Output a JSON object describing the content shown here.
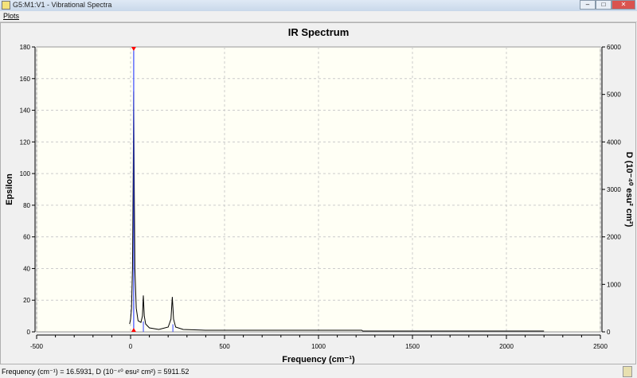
{
  "window": {
    "title": "G5:M1:V1 - Vibrational Spectra",
    "controls": [
      "minimize",
      "maximize",
      "close"
    ]
  },
  "menu": {
    "items": [
      "Plots"
    ]
  },
  "status": {
    "text": "Frequency (cm⁻¹) = 16.5931, D (10⁻⁴⁰ esu² cm²) = 5911.52"
  },
  "chart_data": {
    "type": "line",
    "title": "IR Spectrum",
    "xlabel": "Frequency (cm⁻¹)",
    "ylabel": "Epsilon",
    "y2label": "D (10⁻⁴⁰ esu² cm²)",
    "xlim": [
      -500,
      2500
    ],
    "ylim": [
      0,
      180
    ],
    "y2lim": [
      0,
      6000
    ],
    "xticks": [
      -500,
      0,
      500,
      1000,
      1500,
      2000,
      2500
    ],
    "yticks": [
      0,
      20,
      40,
      60,
      80,
      100,
      120,
      140,
      160,
      180
    ],
    "y2ticks": [
      0,
      1000,
      2000,
      3000,
      4000,
      5000,
      6000
    ],
    "grid": true,
    "colors": {
      "spectrum": "#000000",
      "sticks": "#3040ff",
      "cursor": "#ff0000",
      "background": "#fffff5"
    },
    "spectrum": {
      "x": [
        -5,
        0,
        5,
        10,
        14,
        16.6,
        19,
        23,
        30,
        40,
        55,
        63,
        68,
        73,
        80,
        100,
        150,
        200,
        215,
        222,
        229,
        240,
        280,
        400,
        1230,
        1235,
        2200
      ],
      "y": [
        5,
        8,
        15,
        40,
        100,
        152,
        100,
        40,
        15,
        7,
        6,
        10,
        23,
        10,
        5,
        2.5,
        1.5,
        3,
        8,
        22,
        8,
        3,
        1.5,
        1,
        1,
        0.5,
        0.5
      ]
    },
    "sticks": {
      "x": [
        16.5931,
        68,
        225
      ],
      "D": [
        5911.52,
        220,
        160
      ]
    },
    "cursor": {
      "x": 16.5931
    }
  }
}
